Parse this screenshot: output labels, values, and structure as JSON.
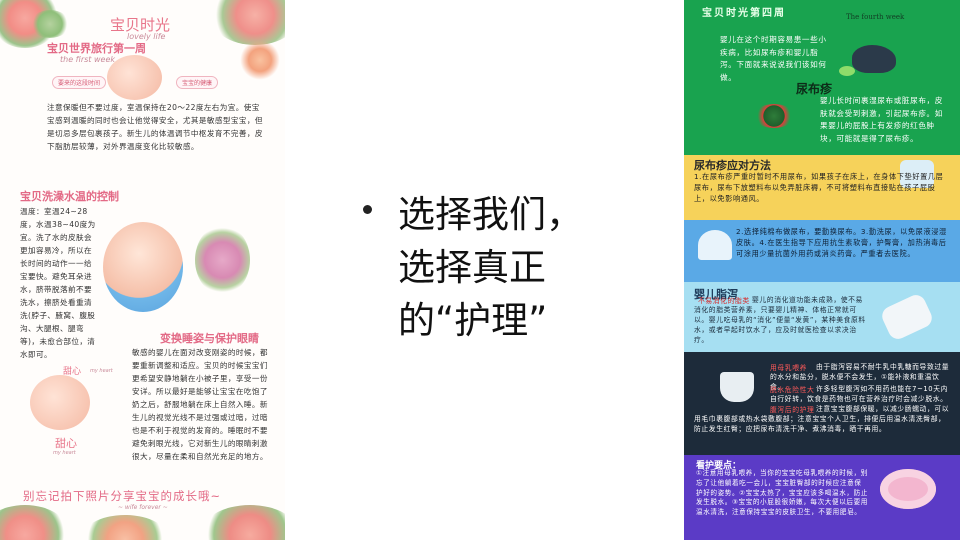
{
  "bullet": {
    "line1": "选择我们，",
    "line2": "选择真正",
    "line3": "的“护理”"
  },
  "left_poster": {
    "title": "宝贝时光",
    "subtitle_en": "lovely life",
    "section1_heading": "宝贝世界旅行第一周",
    "section1_sub": "the first week",
    "tag1": "要来的这段时间",
    "tag2": "宝宝的健康",
    "para1": "注意保暖但不要过度，室温保持在20～22度左右为宜。使宝宝感到温暖的同时也会让他觉得安全，尤其是敏感型宝宝，但是切忌多层包裹孩子。新生儿的体温调节中枢发育不完善，皮下脂肪层较薄，对外界温度变化比较敏感。",
    "section2_heading": "宝贝洗澡水温的控制",
    "para2": "温度：室温24~28度，水温38~40度为宜。洗了水的皮肤会更加容易冷，所以在长时间的动作一一给宝要快。避免耳朵进水，脐带脱落前不要洗水，擦脐处看重清洗(脖子、腋窝、腹股沟、大腿根、腿弯等)，未愈合部位，清水即可。",
    "section3_heading": "变换睡姿与保护眼睛",
    "para3": "敏感的婴儿在面对改变刚姿的时候，都要重新调整和适应。宝贝的时候宝宝们更希望安静地躺在小被子里，享受一份安详。所以最好是能够让宝宝在吃饱了奶之后，舒服地躺在床上自然入睡。新生儿的视觉光线不是过强或过暗，过暗也是不利于视觉的发育的。睡眠时不要避免刺眼光线，它对新生儿的眼睛刺激很大，尽量在柔和自然光充足的地方。",
    "sticker1": "甜心",
    "sticker1_en": "my heart",
    "sticker2": "甜心",
    "sticker2_en": "my heart",
    "footer": "别忘记拍下照片分享宝宝的成长哦~",
    "footer_small": "~ wife forever ~"
  },
  "right_poster": {
    "banner_title": "宝贝时光第四周",
    "banner_en": "The fourth week",
    "intro": "婴儿在这个时期容易患一些小疾病，比如尿布疹和婴儿脂泻。下面就来说说我们该如何做。",
    "diaper_heading": "尿布疹",
    "diaper_text": "婴儿长时间裹湿尿布或脏尿布，皮肤就会受到刺激，引起尿布疹。如果婴儿的屁股上有发疹的红色肿块，可能就是得了尿布疹。",
    "measures_heading": "尿布疹应对方法",
    "measures_text1": "1.在尿布疹严重时暂时不用尿布，如果孩子在床上，在身体下垫好置几层尿布，尿布下放塑料布以免弄脏床褥，不可将塑料布直接贴在孩子屁股上，以免影响通风。",
    "measures_text2": "2.选择纯棉布做尿布，要勤换尿布。3.勤洗尿，以免尿液浸湿皮肤。4.在医生指导下应用抗生素软膏，护臀膏，加热消毒后可涂用少量抗菌外用药或消炎药膏。严重者去医院。",
    "diarrhea_heading": "婴儿脂泻",
    "diarrhea_label": "不易消化的脂类",
    "diarrhea_text": "婴儿的消化道功能未成熟，使不易消化的脂类营养素，只要婴儿精神、体格正常就可以。婴儿吃母乳的“消化”便量“发黄”，某种美食原料水，或者早起时饮水了，应及时就医检查以求决治疗。",
    "dark_label1": "用母乳喂养",
    "dark_text1": "由于脂泻容易不耐牛乳中乳糖而导致过量的水分和盐分，脱水便不会发生，①能补液和重温饮食。",
    "dark_label2": "脱水危险性大",
    "dark_text2": "许多轻型腹泻如不用药也能在7~10天内自行好转，饮食是药物也可在营养治疗时会减少脱水。",
    "dark_label3": "腹泻后的护理",
    "dark_text3": "注意宝宝腹部保暖，以减少肠蠕动，可以用毛巾裹腹部或热水袋敷腹部；注意宝宝个人卫生，排便后用温水清洗臀部，防止发生红臀；应把尿布清洗干净、煮沸消毒，晒干再用。",
    "care_heading": "看护要点：",
    "care_text": "①注意用母乳喂养，当你的宝宝吃母乳喂养的时候，别忘了让他躺着吃一会儿，宝宝脏臀部的时候应注意保护好的姿势。②宝宝太热了，宝宝应该多喝温水，防止发生脱水。③宝宝的小屁股很娇嫩，每次大便以后要用温水清洗，注意保持宝宝的皮肤卫生，不要用肥皂。",
    "colors": {
      "green": "#19a34f",
      "yellow": "#f6d25a",
      "blue": "#5aa9e6",
      "teal": "#a6dff2",
      "dark": "#1d2b3a",
      "purple": "#5b3bc6"
    }
  }
}
